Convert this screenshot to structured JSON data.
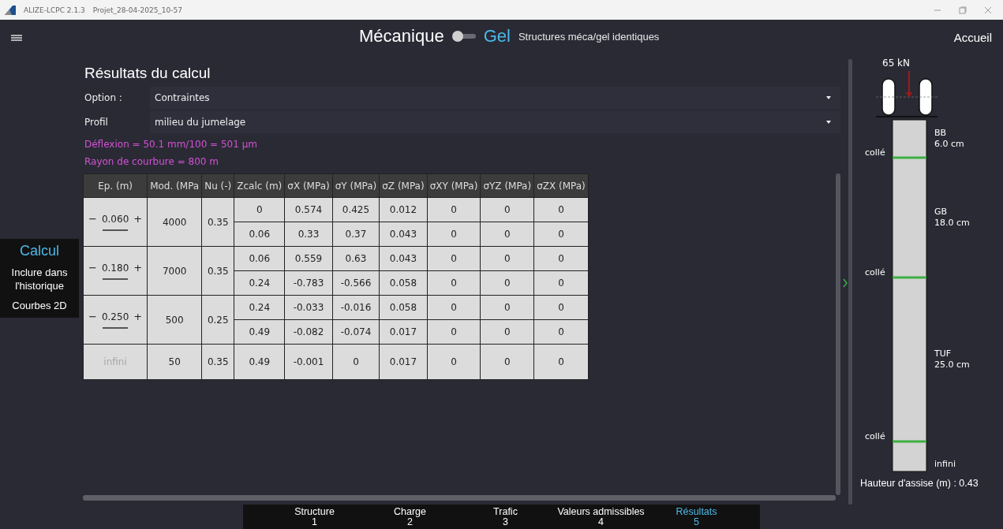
{
  "window": {
    "app": "ALIZE-LCPC 2.1.3",
    "title": "Projet_28-04-2025_10-57"
  },
  "top_bar": {
    "left_label": "Mécanique",
    "toggle": {
      "on": false
    },
    "right_label": "Gel",
    "note": "Structures méca/gel identiques",
    "home": "Accueil"
  },
  "side_menu": [
    {
      "label": "Calcul",
      "selected": true
    },
    {
      "label": "Inclure dans l'historique",
      "selected": false
    },
    {
      "label": "Courbes 2D",
      "selected": false
    }
  ],
  "results": {
    "title": "Résultats du calcul",
    "fields": [
      {
        "label": "Option :",
        "value": "Contraintes"
      },
      {
        "label": "Profil",
        "value": "milieu du jumelage"
      }
    ],
    "notes": [
      "Déflexion = 50.1 mm/100 = 501 µm",
      "Rayon de courbure = 800 m"
    ],
    "table": {
      "columns": [
        "Ep. (m)",
        "Mod. (MPa",
        "Nu (-)",
        "Zcalc (m)",
        "σX (MPa)",
        "σY (MPa)",
        "σZ (MPa)",
        "σXY (MPa)",
        "σYZ (MPa)",
        "σZX (MPa)"
      ],
      "layers": [
        {
          "ep": "0.060",
          "minus": "−",
          "plus": "+",
          "disabled": false,
          "mod": "4000",
          "nu": "0.35",
          "rows": [
            [
              "0",
              "0.574",
              "0.425",
              "0.012",
              "0",
              "0",
              "0"
            ],
            [
              "0.06",
              "0.33",
              "0.37",
              "0.043",
              "0",
              "0",
              "0"
            ]
          ]
        },
        {
          "ep": "0.180",
          "minus": "−",
          "plus": "+",
          "disabled": false,
          "mod": "7000",
          "nu": "0.35",
          "rows": [
            [
              "0.06",
              "0.559",
              "0.63",
              "0.043",
              "0",
              "0",
              "0"
            ],
            [
              "0.24",
              "-0.783",
              "-0.566",
              "0.058",
              "0",
              "0",
              "0"
            ]
          ]
        },
        {
          "ep": "0.250",
          "minus": "−",
          "plus": "+",
          "disabled": false,
          "mod": "500",
          "nu": "0.25",
          "rows": [
            [
              "0.24",
              "-0.033",
              "-0.016",
              "0.058",
              "0",
              "0",
              "0"
            ],
            [
              "0.49",
              "-0.082",
              "-0.074",
              "0.017",
              "0",
              "0",
              "0"
            ]
          ]
        },
        {
          "ep": "infini",
          "disabled": true,
          "mod": "50",
          "nu": "0.35",
          "rows": [
            [
              "0.49",
              "-0.001",
              "0",
              "0.017",
              "0",
              "0",
              "0"
            ]
          ]
        }
      ]
    }
  },
  "diagram": {
    "load": "65 kN",
    "layers": [
      {
        "name": "BB",
        "thickness": "6.0 cm",
        "interface": "collé"
      },
      {
        "name": "GB",
        "thickness": "18.0 cm",
        "interface": "collé"
      },
      {
        "name": "TUF",
        "thickness": "25.0 cm",
        "interface": "collé"
      }
    ],
    "platform": "infini",
    "height_label": "Hauteur d'assise (m) : 0.43"
  },
  "steps": [
    {
      "label": "Structure",
      "number": "1",
      "selected": false
    },
    {
      "label": "Charge",
      "number": "2",
      "selected": false
    },
    {
      "label": "Trafic",
      "number": "3",
      "selected": false
    },
    {
      "label": "Valeurs admissibles",
      "number": "4",
      "selected": false
    },
    {
      "label": "Résultats",
      "number": "5",
      "selected": true
    }
  ]
}
